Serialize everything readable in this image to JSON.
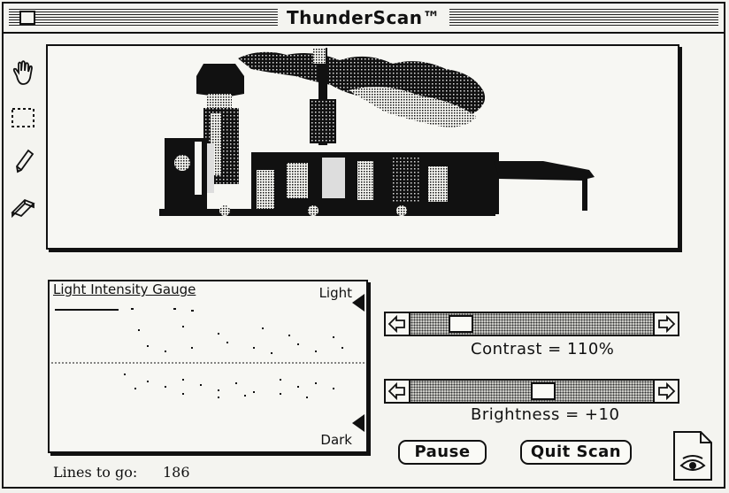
{
  "window": {
    "title": "ThunderScan™"
  },
  "tools": [
    "hand-icon",
    "marquee-select-icon",
    "pencil-icon",
    "eraser-icon"
  ],
  "gauge": {
    "title": "Light Intensity Gauge",
    "light_label": "Light",
    "dark_label": "Dark"
  },
  "status": {
    "lines_label": "Lines to go:",
    "lines_value": "186"
  },
  "contrast": {
    "label": "Contrast = 110%",
    "value_percent": 110,
    "position": 0.18
  },
  "brightness": {
    "label": "Brightness = +10",
    "value": 10,
    "position": 0.55
  },
  "buttons": {
    "pause": "Pause",
    "quit": "Quit Scan"
  },
  "eye_icon": "eye-document-icon"
}
